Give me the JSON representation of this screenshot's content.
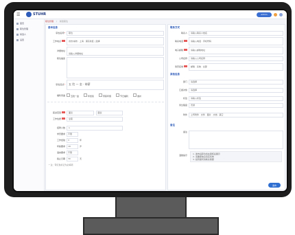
{
  "app": {
    "logo_text": "STUHR",
    "menu_glyph": "☰",
    "user_pill": "admin"
  },
  "sidebar": {
    "items": [
      {
        "label": "首页"
      },
      {
        "label": "职位管理"
      },
      {
        "label": "候选人"
      },
      {
        "label": "设置"
      }
    ]
  },
  "breadcrumb": [
    "职位管理",
    "/",
    "新建职位"
  ],
  "left_panel": {
    "title": "基本信息",
    "rows": [
      {
        "label": "职位名称",
        "value": "职位",
        "required": true
      },
      {
        "label": "工作地点",
        "value": "省份/城市 · 上海 · 浦东新区 | 选择",
        "required": true
      },
      {
        "label": "详细地址",
        "value": "请输入详细地址",
        "required": false
      },
      {
        "label": "职位描述",
        "value": "",
        "required": false
      },
      {
        "label": "职位亮点",
        "value": "五 险 一 金 · 带薪",
        "required": true
      }
    ],
    "checkbox_label": "福利待遇",
    "checkboxes": [
      "五险一金",
      "年终奖",
      "带薪年假",
      "节日福利",
      "餐补"
    ],
    "salary_row": {
      "label": "薪资范围",
      "from": "面议",
      "to": "面议"
    },
    "job_type_row": {
      "label": "工作性质",
      "value": "全职"
    },
    "small_rows": [
      {
        "label": "招聘人数",
        "value": "1",
        "unit": ""
      },
      {
        "label": "学历要求",
        "value": "不限",
        "unit": ""
      },
      {
        "label": "工作经验",
        "value": "3",
        "unit": "年"
      },
      {
        "label": "年龄要求",
        "value": "18",
        "unit": "岁"
      },
      {
        "label": "语言要求",
        "value": "不限",
        "unit": ""
      },
      {
        "label": "截止日期",
        "value": "30",
        "unit": "天"
      }
    ],
    "footer_note": "* 注：带红色标记为必填项"
  },
  "right_panel": {
    "section1_title": "联系方式",
    "section1_rows": [
      {
        "label": "联系人",
        "value": "请输入联系人姓名"
      },
      {
        "label": "联系电话",
        "value": "请输入电话 · 手机号码"
      },
      {
        "label": "电子邮箱",
        "value": "请输入邮箱地址"
      },
      {
        "label": "公司名称",
        "value": "请输入公司名称"
      },
      {
        "label": "简历接收",
        "value": "邮箱 · 系统 · 全部"
      }
    ],
    "section2_title": "其他信息",
    "section2_rows": [
      {
        "label": "部门",
        "value": "请选择"
      },
      {
        "label": "汇报对象",
        "value": "请选择"
      },
      {
        "label": "标签",
        "value": "请输入标签"
      },
      {
        "label": "紧急程度",
        "value": "普通"
      },
      {
        "label": "附件",
        "value": "上传附件 · 文件 · 图片 · 文档 · 其它"
      }
    ],
    "section3_title": "备注",
    "section3_label": "备注",
    "notice_label": "温馨提示",
    "notice_text": "1. 发布后职位将在审核后展示\n2. 请确保信息真实有效\n3. 如有疑问请联系客服",
    "publish_button": "发布"
  },
  "colors": {
    "accent": "#2d5bb9",
    "primary_button": "#2f6fd1",
    "required": "#d33333",
    "bezel": "#1e1e1e"
  }
}
